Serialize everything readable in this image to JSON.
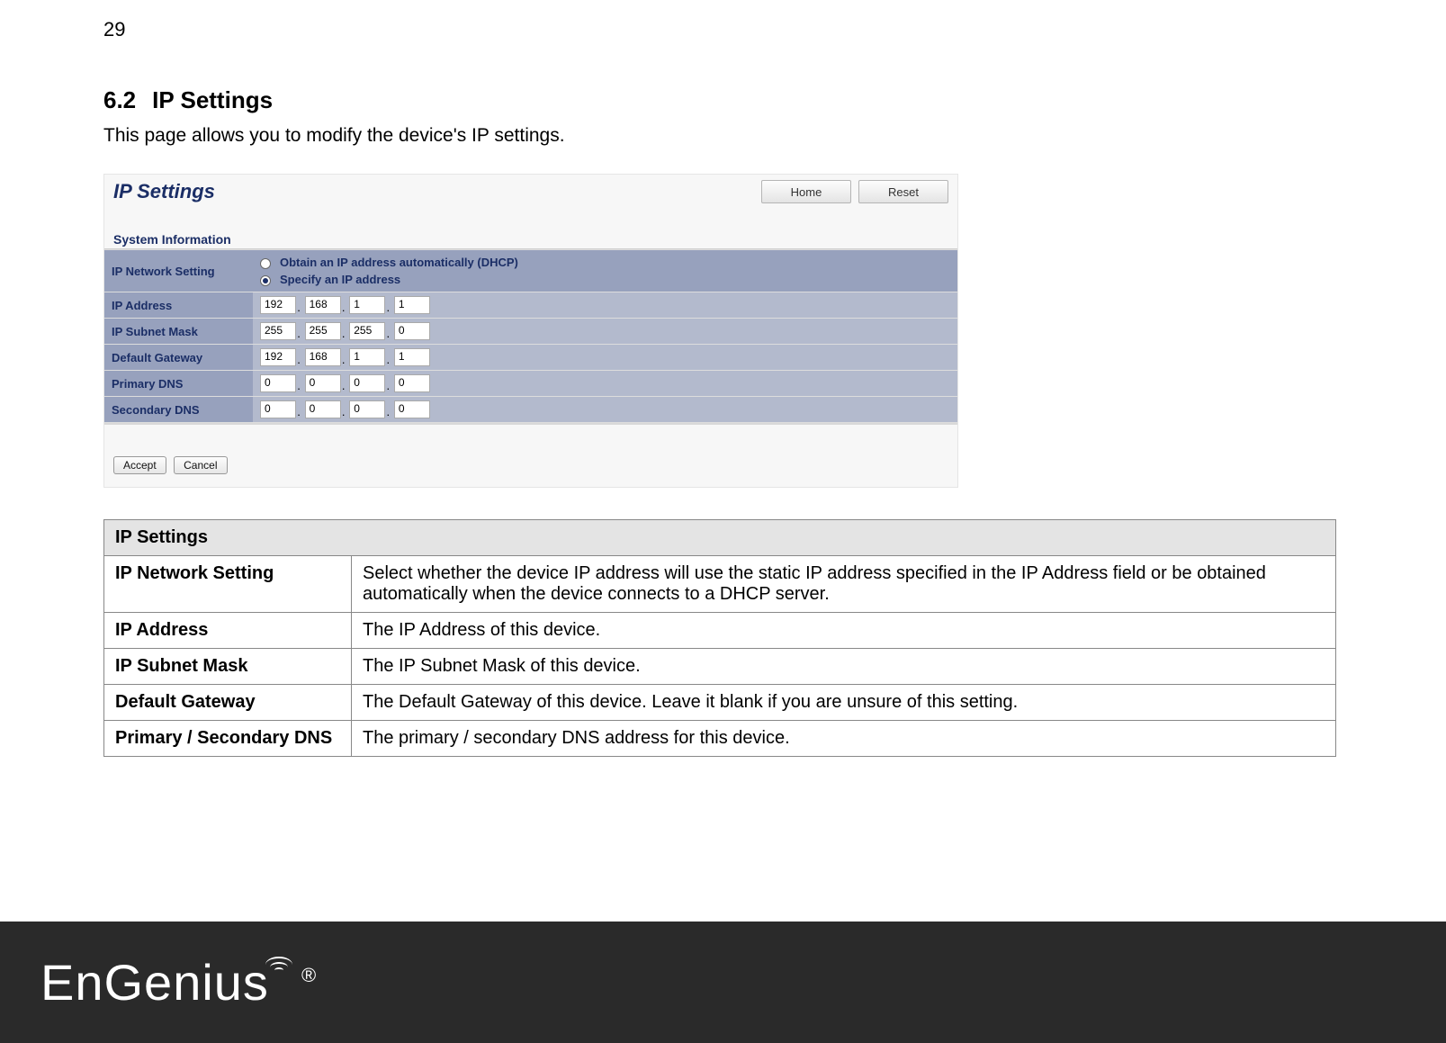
{
  "page_number": "29",
  "heading": {
    "num": "6.2",
    "title": "IP Settings"
  },
  "intro": "This page allows you to modify the device's IP settings.",
  "shot": {
    "title": "IP Settings",
    "home_btn": "Home",
    "reset_btn": "Reset",
    "sysinfo_heading": "System Information",
    "netset_label": "IP Network Setting",
    "opt_dhcp": "Obtain an IP address automatically (DHCP)",
    "opt_static": "Specify an IP address",
    "rows": {
      "ip_address": {
        "label": "IP Address",
        "o": [
          "192",
          "168",
          "1",
          "1"
        ]
      },
      "subnet": {
        "label": "IP Subnet Mask",
        "o": [
          "255",
          "255",
          "255",
          "0"
        ]
      },
      "gateway": {
        "label": "Default Gateway",
        "o": [
          "192",
          "168",
          "1",
          "1"
        ]
      },
      "pdns": {
        "label": "Primary DNS",
        "o": [
          "0",
          "0",
          "0",
          "0"
        ]
      },
      "sdns": {
        "label": "Secondary DNS",
        "o": [
          "0",
          "0",
          "0",
          "0"
        ]
      }
    },
    "accept_btn": "Accept",
    "cancel_btn": "Cancel"
  },
  "desc": {
    "header": "IP Settings",
    "rows": [
      {
        "label": "IP Network Setting",
        "text": "Select whether the device IP address will use the static IP address specified in the IP Address field or be obtained automatically when the device connects to a DHCP server."
      },
      {
        "label": "IP Address",
        "text": "The IP Address of this device."
      },
      {
        "label": "IP Subnet Mask",
        "text": "The IP Subnet Mask of this device."
      },
      {
        "label": "Default Gateway",
        "text": "The Default Gateway of this device. Leave it blank if you are unsure of this setting."
      },
      {
        "label": "Primary / Secondary DNS",
        "text": "The primary / secondary DNS address for this device."
      }
    ]
  },
  "footer": {
    "brand": "EnGenius",
    "reg": "®"
  }
}
